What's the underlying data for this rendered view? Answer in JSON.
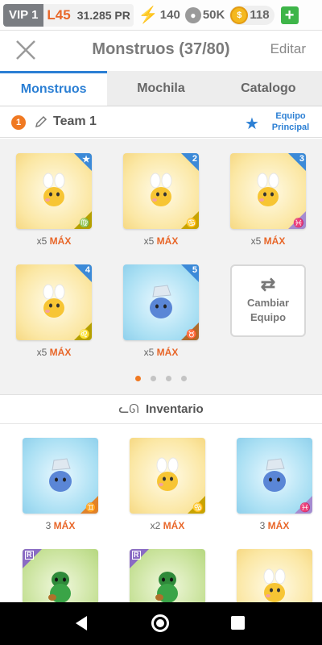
{
  "topbar": {
    "vip": "VIP 1",
    "level": "L45",
    "pr": "31.285 PR",
    "energy": "140",
    "paws": "50K",
    "coins": "118",
    "plus": "+",
    "energy_icon": "bolt-icon",
    "paw_icon": "paw-icon",
    "coin_icon": "coin-icon"
  },
  "header": {
    "title": "Monstruos (37/80)",
    "edit": "Editar",
    "close_icon": "close-icon"
  },
  "tabs": [
    {
      "label": "Monstruos",
      "active": true
    },
    {
      "label": "Mochila",
      "active": false
    },
    {
      "label": "Catalogo",
      "active": false
    }
  ],
  "team": {
    "number": "1",
    "name": "Team 1",
    "main_label_1": "Equipo",
    "main_label_2": "Principal"
  },
  "team_slots": [
    {
      "slot": "★",
      "zodiac": "♍",
      "count": "x5",
      "max": "MÁX",
      "type": "yellow"
    },
    {
      "slot": "2",
      "zodiac": "♋",
      "count": "x5",
      "max": "MÁX",
      "type": "yellow"
    },
    {
      "slot": "3",
      "zodiac": "♓",
      "count": "x5",
      "max": "MÁX",
      "type": "yellow"
    },
    {
      "slot": "4",
      "zodiac": "♌",
      "count": "x5",
      "max": "MÁX",
      "type": "yellow"
    },
    {
      "slot": "5",
      "zodiac": "♉",
      "count": "x5",
      "max": "MÁX",
      "type": "blue"
    }
  ],
  "swap": {
    "line1": "Cambiar",
    "line2": "Equipo",
    "icon": "⇄"
  },
  "pager": {
    "pages": 4,
    "active": 0
  },
  "inventory": {
    "title": "Inventario",
    "items": [
      {
        "zodiac": "♊",
        "count": "3",
        "max": "MÁX",
        "type": "blue"
      },
      {
        "zodiac": "♋",
        "count": "x2",
        "max": "MÁX",
        "type": "yellow"
      },
      {
        "zodiac": "♓",
        "count": "3",
        "max": "MÁX",
        "type": "blue"
      },
      {
        "rarity": "R",
        "type": "green"
      },
      {
        "rarity": "R",
        "type": "green"
      },
      {
        "type": "yellow"
      }
    ]
  },
  "colors": {
    "accent": "#2b7fd4",
    "orange": "#e8672a",
    "green_plus": "#3eb549"
  }
}
